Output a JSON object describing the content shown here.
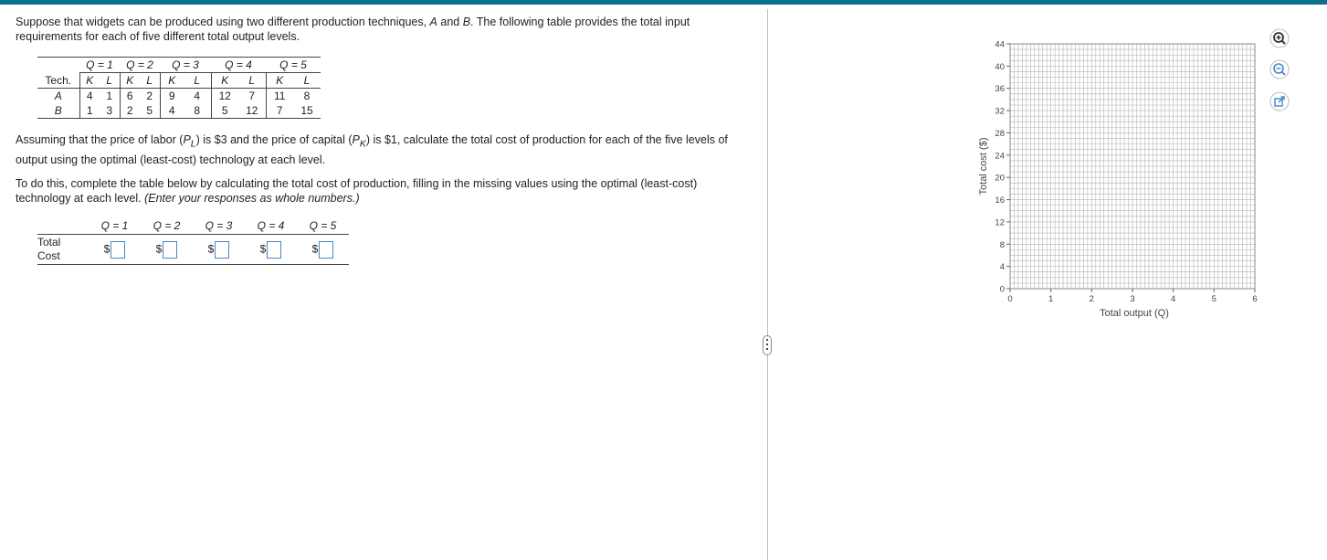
{
  "intro": {
    "text1": "Suppose that widgets can be produced using two different production techniques, ",
    "a": "A",
    "and": " and ",
    "b": "B",
    "text2": ". The following table provides the total input requirements for each of five different total output levels."
  },
  "input_table": {
    "q_headers": [
      "Q = 1",
      "Q = 2",
      "Q = 3",
      "Q = 4",
      "Q = 5"
    ],
    "tech_label": "Tech.",
    "k": "K",
    "l": "L",
    "rows": [
      {
        "tech": "A",
        "values": [
          "4",
          "1",
          "6",
          "2",
          "9",
          "4",
          "12",
          "7",
          "11",
          "8"
        ]
      },
      {
        "tech": "B",
        "values": [
          "1",
          "3",
          "2",
          "5",
          "4",
          "8",
          "5",
          "12",
          "7",
          "15"
        ]
      }
    ]
  },
  "assume": {
    "p1": "Assuming that the price of labor (",
    "pl": "P",
    "pl_sub": "L",
    "p2": ") is $3 and the price of capital (",
    "pk": "P",
    "pk_sub": "K",
    "p3": ") is $1, calculate the total cost of production for each of the five levels of output using the optimal (least-cost) technology at each level."
  },
  "todo": {
    "text": "To do this, complete the table below by calculating the total cost of production, filling in the missing values using the optimal (least-cost) technology at each level. ",
    "note": "(Enter your responses as whole numbers.)"
  },
  "cost_table": {
    "q_headers": [
      "Q = 1",
      "Q = 2",
      "Q = 3",
      "Q = 4",
      "Q = 5"
    ],
    "row_label_1": "Total",
    "row_label_2": "Cost",
    "currency": "$",
    "values": [
      "",
      "",
      "",
      "",
      ""
    ]
  },
  "graph": {
    "ylabel": "Total cost ($)",
    "xlabel": "Total output (Q)",
    "y_ticks": [
      "0",
      "4",
      "8",
      "12",
      "16",
      "20",
      "24",
      "28",
      "32",
      "36",
      "40",
      "44"
    ],
    "x_ticks": [
      "0",
      "1",
      "2",
      "3",
      "4",
      "5",
      "6"
    ]
  },
  "tools": [
    "zoom-in-icon",
    "zoom-out-icon",
    "open-external-icon"
  ]
}
